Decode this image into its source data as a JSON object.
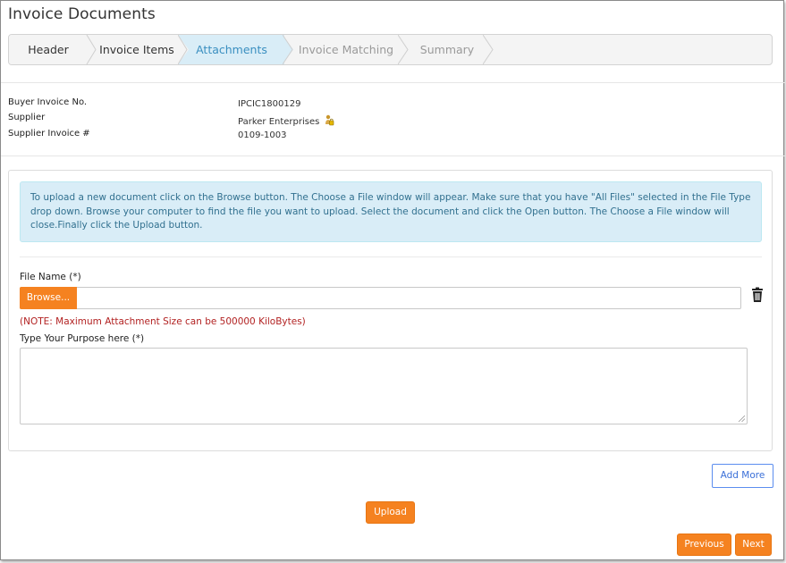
{
  "page": {
    "title": "Invoice Documents"
  },
  "wizard": {
    "steps": [
      {
        "label": "Header",
        "state": "completed"
      },
      {
        "label": "Invoice Items",
        "state": "completed"
      },
      {
        "label": "Attachments",
        "state": "active"
      },
      {
        "label": "Invoice Matching",
        "state": "pending"
      },
      {
        "label": "Summary",
        "state": "pending"
      }
    ]
  },
  "invoice_info": {
    "buyer_invoice_label": "Buyer Invoice No.",
    "buyer_invoice_value": "IPCIC1800129",
    "supplier_label": "Supplier",
    "supplier_value": "Parker Enterprises",
    "supplier_invoice_label": "Supplier Invoice #",
    "supplier_invoice_value": "0109-1003"
  },
  "upload_panel": {
    "instructions": "To upload a new document click on the Browse button. The Choose a File window will appear. Make sure that you have \"All Files\" selected in the File Type drop down. Browse your computer to find the file you want to upload. Select the document and click the Open button. The Choose a File window will close.Finally click the Upload button.",
    "file_name_label": "File Name (*)",
    "browse_label": "Browse...",
    "file_name_value": "",
    "note": "(NOTE: Maximum Attachment Size can be 500000 KiloBytes)",
    "purpose_label": "Type Your Purpose here (*)",
    "purpose_value": ""
  },
  "actions": {
    "add_more_label": "Add More",
    "upload_label": "Upload",
    "previous_label": "Previous",
    "next_label": "Next"
  },
  "colors": {
    "accent_orange": "#f58220",
    "active_step_bg": "#d9edf7",
    "active_step_text": "#3a8fc0",
    "alert_bg": "#d9edf7",
    "alert_text": "#31708f",
    "note_text": "#b22222"
  },
  "icons": {
    "supplier_badge": "person-lock-icon",
    "delete": "trash-icon"
  }
}
